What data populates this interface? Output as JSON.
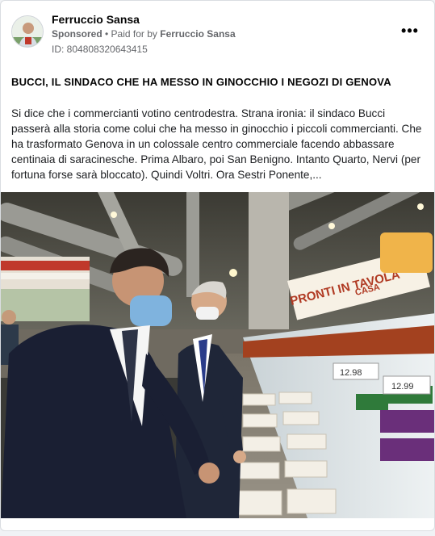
{
  "post": {
    "advertiser": "Ferruccio Sansa",
    "sponsored_label": "Sponsored",
    "separator": " • ",
    "paid_for_prefix": "Paid for by ",
    "paid_for_name": "Ferruccio Sansa",
    "ad_id": "ID: 804808320643415",
    "more_label": "•••",
    "headline": "BUCCI, IL SINDACO CHE HA MESSO IN GINOCCHIO I NEGOZI DI GENOVA",
    "body": "Si dice che i commercianti votino centrodestra. Strana ironia: il sindaco Bucci passerà alla storia come colui che ha messo in ginocchio i piccoli commercianti. Che ha trasformato Genova in un colossale centro commerciale facendo abbassare centinaia di saracinesche. Prima Albaro, poi San Benigno. Intanto Quarto, Nervi (per fortuna forse sarà bloccato). Quindi Voltri. Ora Sestri Ponente,..."
  },
  "image": {
    "store_banner": "PRONTI IN TAVOLA",
    "store_banner_sub": "CASA",
    "price_1": "12.98",
    "price_2": "12.99"
  },
  "colors": {
    "card_bg": "#ffffff",
    "meta_gray": "#65676b",
    "text_dark": "#050505"
  }
}
